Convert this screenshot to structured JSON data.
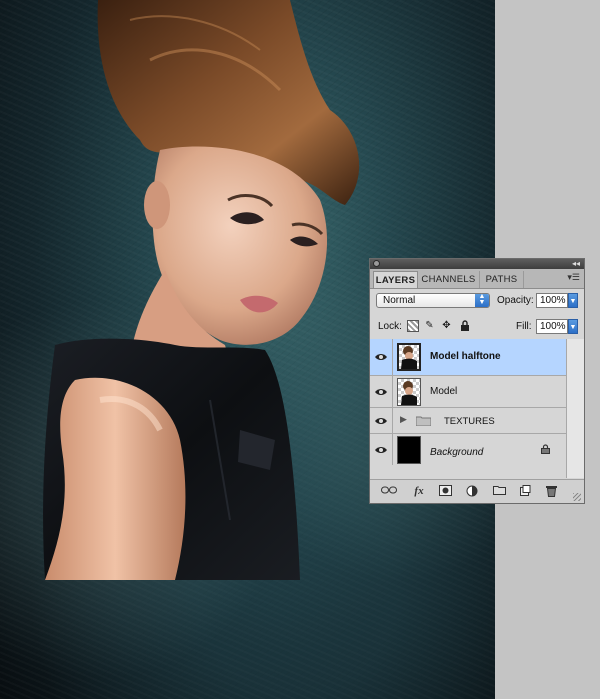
{
  "panel": {
    "tabs": [
      {
        "label": "LAYERS"
      },
      {
        "label": "CHANNELS"
      },
      {
        "label": "PATHS"
      }
    ],
    "blend_mode": "Normal",
    "opacity_label": "Opacity:",
    "opacity_value": "100%",
    "lock_label": "Lock:",
    "fill_label": "Fill:",
    "fill_value": "100%",
    "layers": [
      {
        "name": "Model halftone",
        "selected": true,
        "type": "pixel"
      },
      {
        "name": "Model",
        "selected": false,
        "type": "pixel"
      },
      {
        "name": "TEXTURES",
        "selected": false,
        "type": "group"
      },
      {
        "name": "Background",
        "selected": false,
        "type": "background",
        "locked": true
      }
    ],
    "fx_label": "fx"
  },
  "colors": {
    "selected_row": "#b5d5ff",
    "panel_bg": "#d6d6d6",
    "canvas_teal": "#25484f",
    "side_gray": "#c4c4c4"
  }
}
